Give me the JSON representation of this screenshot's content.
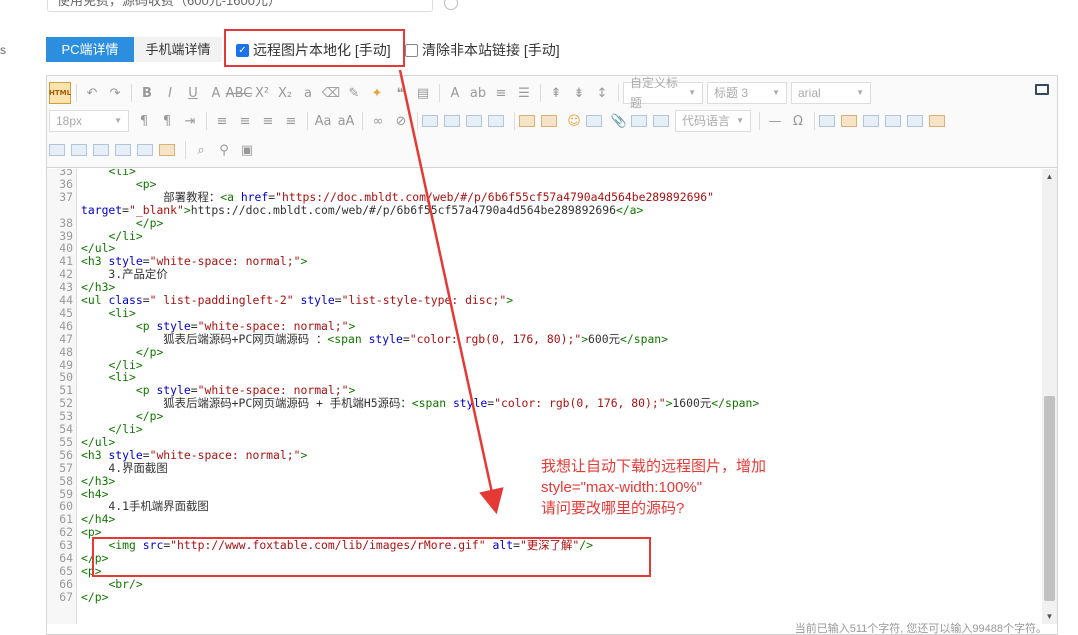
{
  "top_input": {
    "value": "使用免费，源码收费（600元-1600元）"
  },
  "left_label": "s",
  "tabs": [
    {
      "label": "PC端详情"
    },
    {
      "label": "手机端详情"
    }
  ],
  "options": {
    "local_images": {
      "label": "远程图片本地化 [手动]",
      "checked": true
    },
    "clear_links": {
      "label": "清除非本站链接 [手动]",
      "checked": false
    }
  },
  "toolbar": {
    "html_label": "HTML",
    "format_heading": "自定义标题",
    "heading_level": "标题 3",
    "font_family": "arial",
    "font_size": "18px",
    "code_language": "代码语言"
  },
  "code_lines": [
    {
      "n": "35",
      "parts": [
        [
          "",
          "    "
        ],
        [
          "t-tag",
          "<li>"
        ]
      ]
    },
    {
      "n": "36",
      "parts": [
        [
          "",
          "        "
        ],
        [
          "t-tag",
          "<p>"
        ]
      ]
    },
    {
      "n": "37",
      "parts": [
        [
          "",
          "            部署教程："
        ],
        [
          "t-tag",
          "<a "
        ],
        [
          "t-attr",
          "href"
        ],
        [
          "",
          "="
        ],
        [
          "t-str",
          "\"https://doc.mbldt.com/web/#/p/6b6f55cf57a4790a4d564be289892696\""
        ]
      ]
    },
    {
      "n": "",
      "parts": [
        [
          "t-attr",
          "target"
        ],
        [
          "",
          "="
        ],
        [
          "t-str",
          "\"_blank\""
        ],
        [
          "t-tag",
          ">"
        ],
        [
          "",
          "https://doc.mbldt.com/web/#/p/6b6f55cf57a4790a4d564be289892696"
        ],
        [
          "t-tag",
          "</a>"
        ]
      ]
    },
    {
      "n": "38",
      "parts": [
        [
          "",
          "        "
        ],
        [
          "t-tag",
          "</p>"
        ]
      ]
    },
    {
      "n": "39",
      "parts": [
        [
          "",
          "    "
        ],
        [
          "t-tag",
          "</li>"
        ]
      ]
    },
    {
      "n": "40",
      "parts": [
        [
          "t-tag",
          "</ul>"
        ]
      ]
    },
    {
      "n": "41",
      "parts": [
        [
          "t-tag",
          "<h3 "
        ],
        [
          "t-attr",
          "style"
        ],
        [
          "",
          "="
        ],
        [
          "t-str",
          "\"white-space: normal;\""
        ],
        [
          "t-tag",
          ">"
        ]
      ]
    },
    {
      "n": "42",
      "parts": [
        [
          "",
          "    3.产品定价"
        ]
      ]
    },
    {
      "n": "43",
      "parts": [
        [
          "t-tag",
          "</h3>"
        ]
      ]
    },
    {
      "n": "44",
      "parts": [
        [
          "t-tag",
          "<ul "
        ],
        [
          "t-attr",
          "class"
        ],
        [
          "",
          "="
        ],
        [
          "t-str",
          "\" list-paddingleft-2\""
        ],
        [
          "",
          " "
        ],
        [
          "t-attr",
          "style"
        ],
        [
          "",
          "="
        ],
        [
          "t-str",
          "\"list-style-type: disc;\""
        ],
        [
          "t-tag",
          ">"
        ]
      ]
    },
    {
      "n": "45",
      "parts": [
        [
          "",
          "    "
        ],
        [
          "t-tag",
          "<li>"
        ]
      ]
    },
    {
      "n": "46",
      "parts": [
        [
          "",
          "        "
        ],
        [
          "t-tag",
          "<p "
        ],
        [
          "t-attr",
          "style"
        ],
        [
          "",
          "="
        ],
        [
          "t-str",
          "\"white-space: normal;\""
        ],
        [
          "t-tag",
          ">"
        ]
      ]
    },
    {
      "n": "47",
      "parts": [
        [
          "",
          "            狐表后端源码+PC网页端源码 ："
        ],
        [
          "t-tag",
          "<span "
        ],
        [
          "t-attr",
          "style"
        ],
        [
          "",
          "="
        ],
        [
          "t-str",
          "\"color: rgb(0, 176, 80);\""
        ],
        [
          "t-tag",
          ">"
        ],
        [
          "",
          "600元"
        ],
        [
          "t-tag",
          "</span>"
        ]
      ]
    },
    {
      "n": "48",
      "parts": [
        [
          "",
          "        "
        ],
        [
          "t-tag",
          "</p>"
        ]
      ]
    },
    {
      "n": "49",
      "parts": [
        [
          "",
          "    "
        ],
        [
          "t-tag",
          "</li>"
        ]
      ]
    },
    {
      "n": "50",
      "parts": [
        [
          "",
          "    "
        ],
        [
          "t-tag",
          "<li>"
        ]
      ]
    },
    {
      "n": "51",
      "parts": [
        [
          "",
          "        "
        ],
        [
          "t-tag",
          "<p "
        ],
        [
          "t-attr",
          "style"
        ],
        [
          "",
          "="
        ],
        [
          "t-str",
          "\"white-space: normal;\""
        ],
        [
          "t-tag",
          ">"
        ]
      ]
    },
    {
      "n": "52",
      "parts": [
        [
          "",
          "            狐表后端源码+PC网页端源码 + 手机端H5源码："
        ],
        [
          "t-tag",
          "<span "
        ],
        [
          "t-attr",
          "style"
        ],
        [
          "",
          "="
        ],
        [
          "t-str",
          "\"color: rgb(0, 176, 80);\""
        ],
        [
          "t-tag",
          ">"
        ],
        [
          "",
          "1600元"
        ],
        [
          "t-tag",
          "</span>"
        ]
      ]
    },
    {
      "n": "53",
      "parts": [
        [
          "",
          "        "
        ],
        [
          "t-tag",
          "</p>"
        ]
      ]
    },
    {
      "n": "54",
      "parts": [
        [
          "",
          "    "
        ],
        [
          "t-tag",
          "</li>"
        ]
      ]
    },
    {
      "n": "55",
      "parts": [
        [
          "t-tag",
          "</ul>"
        ]
      ]
    },
    {
      "n": "56",
      "parts": [
        [
          "t-tag",
          "<h3 "
        ],
        [
          "t-attr",
          "style"
        ],
        [
          "",
          "="
        ],
        [
          "t-str",
          "\"white-space: normal;\""
        ],
        [
          "t-tag",
          ">"
        ]
      ]
    },
    {
      "n": "57",
      "parts": [
        [
          "",
          "    4.界面截图"
        ]
      ]
    },
    {
      "n": "58",
      "parts": [
        [
          "t-tag",
          "</h3>"
        ]
      ]
    },
    {
      "n": "59",
      "parts": [
        [
          "t-tag",
          "<h4>"
        ]
      ]
    },
    {
      "n": "60",
      "parts": [
        [
          "",
          "    4.1手机端界面截图"
        ]
      ]
    },
    {
      "n": "61",
      "parts": [
        [
          "t-tag",
          "</h4>"
        ]
      ]
    },
    {
      "n": "62",
      "parts": [
        [
          "t-tag",
          "<p>"
        ]
      ]
    },
    {
      "n": "63",
      "parts": [
        [
          "",
          "    "
        ],
        [
          "t-tag",
          "<img "
        ],
        [
          "t-attr",
          "src"
        ],
        [
          "",
          "="
        ],
        [
          "t-str",
          "\"http://www.foxtable.com/lib/images/rMore.gif\""
        ],
        [
          "",
          " "
        ],
        [
          "t-attr",
          "alt"
        ],
        [
          "",
          "="
        ],
        [
          "t-str",
          "\"更深了解\""
        ],
        [
          "t-tag",
          "/>"
        ]
      ]
    },
    {
      "n": "64",
      "parts": [
        [
          "t-tag",
          "</p>"
        ]
      ]
    },
    {
      "n": "65",
      "parts": [
        [
          "t-tag",
          "<p>"
        ]
      ]
    },
    {
      "n": "66",
      "parts": [
        [
          "",
          "    "
        ],
        [
          "t-tag",
          "<br/>"
        ]
      ]
    },
    {
      "n": "67",
      "parts": [
        [
          "t-tag",
          "</p>"
        ]
      ]
    }
  ],
  "status_text": "当前已输入511个字符, 您还可以输入99488个字符。",
  "annotation": {
    "line1": "我想让自动下载的远程图片，增加",
    "line2": "style=\"max-width:100%\"",
    "line3": "请问要改哪里的源码?"
  },
  "colors": {
    "accent": "#2b8edf",
    "highlight": "#e53935"
  }
}
